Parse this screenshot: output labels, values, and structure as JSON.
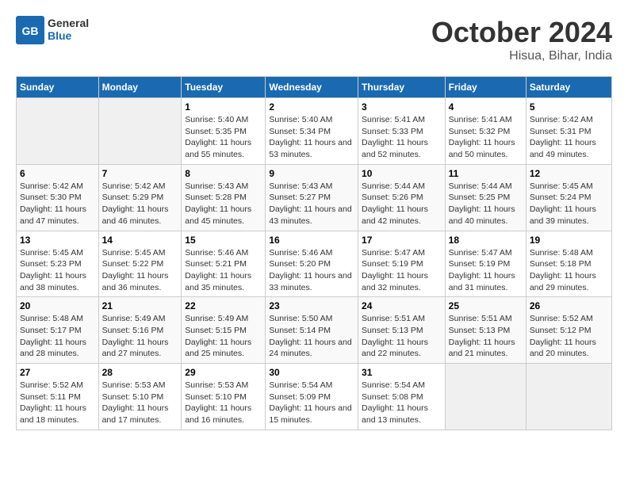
{
  "header": {
    "logo_general": "General",
    "logo_blue": "Blue",
    "title": "October 2024",
    "subtitle": "Hisua, Bihar, India"
  },
  "weekdays": [
    "Sunday",
    "Monday",
    "Tuesday",
    "Wednesday",
    "Thursday",
    "Friday",
    "Saturday"
  ],
  "weeks": [
    [
      {
        "day": "",
        "sunrise": "",
        "sunset": "",
        "daylight": ""
      },
      {
        "day": "",
        "sunrise": "",
        "sunset": "",
        "daylight": ""
      },
      {
        "day": "1",
        "sunrise": "Sunrise: 5:40 AM",
        "sunset": "Sunset: 5:35 PM",
        "daylight": "Daylight: 11 hours and 55 minutes."
      },
      {
        "day": "2",
        "sunrise": "Sunrise: 5:40 AM",
        "sunset": "Sunset: 5:34 PM",
        "daylight": "Daylight: 11 hours and 53 minutes."
      },
      {
        "day": "3",
        "sunrise": "Sunrise: 5:41 AM",
        "sunset": "Sunset: 5:33 PM",
        "daylight": "Daylight: 11 hours and 52 minutes."
      },
      {
        "day": "4",
        "sunrise": "Sunrise: 5:41 AM",
        "sunset": "Sunset: 5:32 PM",
        "daylight": "Daylight: 11 hours and 50 minutes."
      },
      {
        "day": "5",
        "sunrise": "Sunrise: 5:42 AM",
        "sunset": "Sunset: 5:31 PM",
        "daylight": "Daylight: 11 hours and 49 minutes."
      }
    ],
    [
      {
        "day": "6",
        "sunrise": "Sunrise: 5:42 AM",
        "sunset": "Sunset: 5:30 PM",
        "daylight": "Daylight: 11 hours and 47 minutes."
      },
      {
        "day": "7",
        "sunrise": "Sunrise: 5:42 AM",
        "sunset": "Sunset: 5:29 PM",
        "daylight": "Daylight: 11 hours and 46 minutes."
      },
      {
        "day": "8",
        "sunrise": "Sunrise: 5:43 AM",
        "sunset": "Sunset: 5:28 PM",
        "daylight": "Daylight: 11 hours and 45 minutes."
      },
      {
        "day": "9",
        "sunrise": "Sunrise: 5:43 AM",
        "sunset": "Sunset: 5:27 PM",
        "daylight": "Daylight: 11 hours and 43 minutes."
      },
      {
        "day": "10",
        "sunrise": "Sunrise: 5:44 AM",
        "sunset": "Sunset: 5:26 PM",
        "daylight": "Daylight: 11 hours and 42 minutes."
      },
      {
        "day": "11",
        "sunrise": "Sunrise: 5:44 AM",
        "sunset": "Sunset: 5:25 PM",
        "daylight": "Daylight: 11 hours and 40 minutes."
      },
      {
        "day": "12",
        "sunrise": "Sunrise: 5:45 AM",
        "sunset": "Sunset: 5:24 PM",
        "daylight": "Daylight: 11 hours and 39 minutes."
      }
    ],
    [
      {
        "day": "13",
        "sunrise": "Sunrise: 5:45 AM",
        "sunset": "Sunset: 5:23 PM",
        "daylight": "Daylight: 11 hours and 38 minutes."
      },
      {
        "day": "14",
        "sunrise": "Sunrise: 5:45 AM",
        "sunset": "Sunset: 5:22 PM",
        "daylight": "Daylight: 11 hours and 36 minutes."
      },
      {
        "day": "15",
        "sunrise": "Sunrise: 5:46 AM",
        "sunset": "Sunset: 5:21 PM",
        "daylight": "Daylight: 11 hours and 35 minutes."
      },
      {
        "day": "16",
        "sunrise": "Sunrise: 5:46 AM",
        "sunset": "Sunset: 5:20 PM",
        "daylight": "Daylight: 11 hours and 33 minutes."
      },
      {
        "day": "17",
        "sunrise": "Sunrise: 5:47 AM",
        "sunset": "Sunset: 5:19 PM",
        "daylight": "Daylight: 11 hours and 32 minutes."
      },
      {
        "day": "18",
        "sunrise": "Sunrise: 5:47 AM",
        "sunset": "Sunset: 5:19 PM",
        "daylight": "Daylight: 11 hours and 31 minutes."
      },
      {
        "day": "19",
        "sunrise": "Sunrise: 5:48 AM",
        "sunset": "Sunset: 5:18 PM",
        "daylight": "Daylight: 11 hours and 29 minutes."
      }
    ],
    [
      {
        "day": "20",
        "sunrise": "Sunrise: 5:48 AM",
        "sunset": "Sunset: 5:17 PM",
        "daylight": "Daylight: 11 hours and 28 minutes."
      },
      {
        "day": "21",
        "sunrise": "Sunrise: 5:49 AM",
        "sunset": "Sunset: 5:16 PM",
        "daylight": "Daylight: 11 hours and 27 minutes."
      },
      {
        "day": "22",
        "sunrise": "Sunrise: 5:49 AM",
        "sunset": "Sunset: 5:15 PM",
        "daylight": "Daylight: 11 hours and 25 minutes."
      },
      {
        "day": "23",
        "sunrise": "Sunrise: 5:50 AM",
        "sunset": "Sunset: 5:14 PM",
        "daylight": "Daylight: 11 hours and 24 minutes."
      },
      {
        "day": "24",
        "sunrise": "Sunrise: 5:51 AM",
        "sunset": "Sunset: 5:13 PM",
        "daylight": "Daylight: 11 hours and 22 minutes."
      },
      {
        "day": "25",
        "sunrise": "Sunrise: 5:51 AM",
        "sunset": "Sunset: 5:13 PM",
        "daylight": "Daylight: 11 hours and 21 minutes."
      },
      {
        "day": "26",
        "sunrise": "Sunrise: 5:52 AM",
        "sunset": "Sunset: 5:12 PM",
        "daylight": "Daylight: 11 hours and 20 minutes."
      }
    ],
    [
      {
        "day": "27",
        "sunrise": "Sunrise: 5:52 AM",
        "sunset": "Sunset: 5:11 PM",
        "daylight": "Daylight: 11 hours and 18 minutes."
      },
      {
        "day": "28",
        "sunrise": "Sunrise: 5:53 AM",
        "sunset": "Sunset: 5:10 PM",
        "daylight": "Daylight: 11 hours and 17 minutes."
      },
      {
        "day": "29",
        "sunrise": "Sunrise: 5:53 AM",
        "sunset": "Sunset: 5:10 PM",
        "daylight": "Daylight: 11 hours and 16 minutes."
      },
      {
        "day": "30",
        "sunrise": "Sunrise: 5:54 AM",
        "sunset": "Sunset: 5:09 PM",
        "daylight": "Daylight: 11 hours and 15 minutes."
      },
      {
        "day": "31",
        "sunrise": "Sunrise: 5:54 AM",
        "sunset": "Sunset: 5:08 PM",
        "daylight": "Daylight: 11 hours and 13 minutes."
      },
      {
        "day": "",
        "sunrise": "",
        "sunset": "",
        "daylight": ""
      },
      {
        "day": "",
        "sunrise": "",
        "sunset": "",
        "daylight": ""
      }
    ]
  ]
}
